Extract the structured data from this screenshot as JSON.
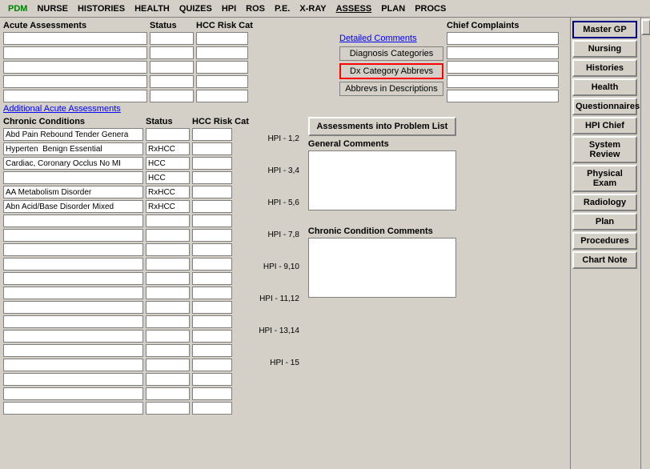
{
  "menu": {
    "items": [
      {
        "label": "PDM",
        "style": "green"
      },
      {
        "label": "NURSE"
      },
      {
        "label": "HISTORIES"
      },
      {
        "label": "HEALTH"
      },
      {
        "label": "QUIZES"
      },
      {
        "label": "HPI"
      },
      {
        "label": "ROS"
      },
      {
        "label": "P.E."
      },
      {
        "label": "X-RAY"
      },
      {
        "label": "ASSESS",
        "underline": true
      },
      {
        "label": "PLAN"
      },
      {
        "label": "PROCS"
      }
    ]
  },
  "sections": {
    "acute_header": "Acute Assessments",
    "status_header": "Status",
    "hcc_header": "HCC Risk Cat",
    "chief_header": "Chief Complaints",
    "chronic_header": "Chronic Conditions",
    "chronic_status_header": "Status",
    "chronic_hcc_header": "HCC Risk Cat"
  },
  "links": {
    "detailed_comments": "Detailed Comments",
    "additional_acute": "Additional Acute Assessments"
  },
  "buttons": {
    "diagnosis_categories": "Diagnosis Categories",
    "dx_category_abbrevs": "Dx Category Abbrevs",
    "abbrevs_in_descriptions": "Abbrevs in Descriptions",
    "assessments_into_problem_list": "Assessments into Problem List",
    "master_gp": "Master GP",
    "nursing": "Nursing",
    "histories": "Histories",
    "health": "Health",
    "questionnaires": "Questionnaires",
    "hpi_chief": "HPI Chief",
    "system_review": "System Review",
    "physical_exam": "Physical Exam",
    "radiology": "Radiology",
    "plan": "Plan",
    "procedures": "Procedures",
    "chart_note": "Chart Note"
  },
  "labels": {
    "general_comments": "General Comments",
    "chronic_condition_comments": "Chronic Condition Comments"
  },
  "chronic_data": [
    {
      "condition": "Abd Pain Rebound Tender Genera",
      "status": "",
      "hpi": "HPI - 1,2"
    },
    {
      "condition": "Hyperten  Benign Essential",
      "status": "RxHCC",
      "hpi": ""
    },
    {
      "condition": "Cardiac, Coronary Occlus No MI",
      "status": "HCC",
      "hpi": "HPI - 3,4"
    },
    {
      "condition": "",
      "status": "HCC",
      "hpi": ""
    },
    {
      "condition": "AA Metabolism Disorder",
      "status": "RxHCC",
      "hpi": "HPI - 5,6"
    },
    {
      "condition": "Abn Acid/Base Disorder Mixed",
      "status": "RxHCC",
      "hpi": ""
    },
    {
      "condition": "",
      "status": "",
      "hpi": "HPI - 7,8"
    },
    {
      "condition": "",
      "status": "",
      "hpi": ""
    },
    {
      "condition": "",
      "status": "",
      "hpi": "HPI - 9,10"
    },
    {
      "condition": "",
      "status": "",
      "hpi": ""
    },
    {
      "condition": "",
      "status": "",
      "hpi": "HPI - 11,12"
    },
    {
      "condition": "",
      "status": "",
      "hpi": ""
    },
    {
      "condition": "",
      "status": "",
      "hpi": "HPI - 13,14"
    },
    {
      "condition": "",
      "status": "",
      "hpi": ""
    },
    {
      "condition": "",
      "status": "",
      "hpi": "HPI - 15"
    },
    {
      "condition": "",
      "status": "",
      "hpi": ""
    },
    {
      "condition": "",
      "status": "",
      "hpi": ""
    },
    {
      "condition": "",
      "status": "",
      "hpi": ""
    },
    {
      "condition": "",
      "status": "",
      "hpi": ""
    },
    {
      "condition": "",
      "status": "",
      "hpi": ""
    }
  ]
}
